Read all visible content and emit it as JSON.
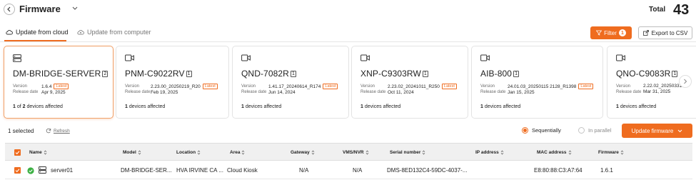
{
  "header": {
    "title": "Firmware",
    "total_label": "Total",
    "total_value": "43"
  },
  "tabs": [
    {
      "label": "Update from cloud",
      "active": true
    },
    {
      "label": "Update from computer",
      "active": false
    }
  ],
  "toolbar": {
    "filter_label": "Filter",
    "filter_count": "1",
    "export_label": "Export to CSV"
  },
  "labels": {
    "version": "Version",
    "release_date": "Release date",
    "latest": "Latest"
  },
  "cards": [
    {
      "model": "DM-BRIDGE-SERVER",
      "count": "2",
      "version": "1.6.4",
      "latest": true,
      "release_date": "Apr 9, 2025",
      "affected_pre": "1",
      "affected_mid": " of ",
      "affected_bold2": "2",
      "affected_post": " devices affected",
      "icon": "server-icon"
    },
    {
      "model": "PNM-C9022RV",
      "count": "1",
      "version": "2.23.00_20250219_R20",
      "latest": true,
      "release_date": "Feb 19, 2025",
      "affected_pre": "1",
      "affected_post": " devices affected",
      "icon": "camera-icon"
    },
    {
      "model": "QND-7082R",
      "count": "1",
      "version": "1.41.17_20240614_R174",
      "latest": true,
      "release_date": "Jun 14, 2024",
      "affected_pre": "1",
      "affected_post": " devices affected",
      "icon": "camera-icon"
    },
    {
      "model": "XNP-C9303RW",
      "count": "1",
      "version": "2.23.02_20241011_R250",
      "latest": true,
      "release_date": "Oct 11, 2024",
      "affected_pre": "1",
      "affected_post": " devices affected",
      "icon": "camera-icon"
    },
    {
      "model": "AIB-800",
      "count": "1",
      "version": "24.01.03_20250115 2128_R1398",
      "latest": true,
      "release_date": "Jan 15, 2025",
      "affected_pre": "1",
      "affected_post": " devices affected",
      "icon": "camera-icon"
    },
    {
      "model": "QNO-C9083R",
      "count": "1",
      "version": "2.22.02_20250331",
      "latest": false,
      "release_date": "Mar 31, 2025",
      "affected_pre": "1",
      "affected_post": " devices affected",
      "icon": "camera-icon"
    }
  ],
  "selection": {
    "count_text": "1 selected",
    "refresh_label": "Refresh",
    "sequential_label": "Sequentially",
    "parallel_label": "In parallel",
    "mode": "sequential",
    "update_label": "Update firmware"
  },
  "table": {
    "columns": [
      "Name",
      "Model",
      "Location",
      "Area",
      "Gateway",
      "VMS/NVR",
      "Serial number",
      "IP address",
      "MAC address",
      "Firmware"
    ],
    "rows": [
      {
        "name": "server01",
        "model": "DM-BRIDGE-SER...",
        "location": "HVA IRVINE CA ...",
        "area": "Cloud Kiosk",
        "gateway": "N/A",
        "vms": "N/A",
        "serial": "DMS-8ED132C4-59DC-4037-...",
        "ip": "",
        "mac": "E8:80:88:C3:A7:64",
        "firmware": "1.6.1",
        "status": "online"
      }
    ]
  },
  "colors": {
    "accent": "#ef6c1f",
    "status_online": "#3cb043"
  }
}
